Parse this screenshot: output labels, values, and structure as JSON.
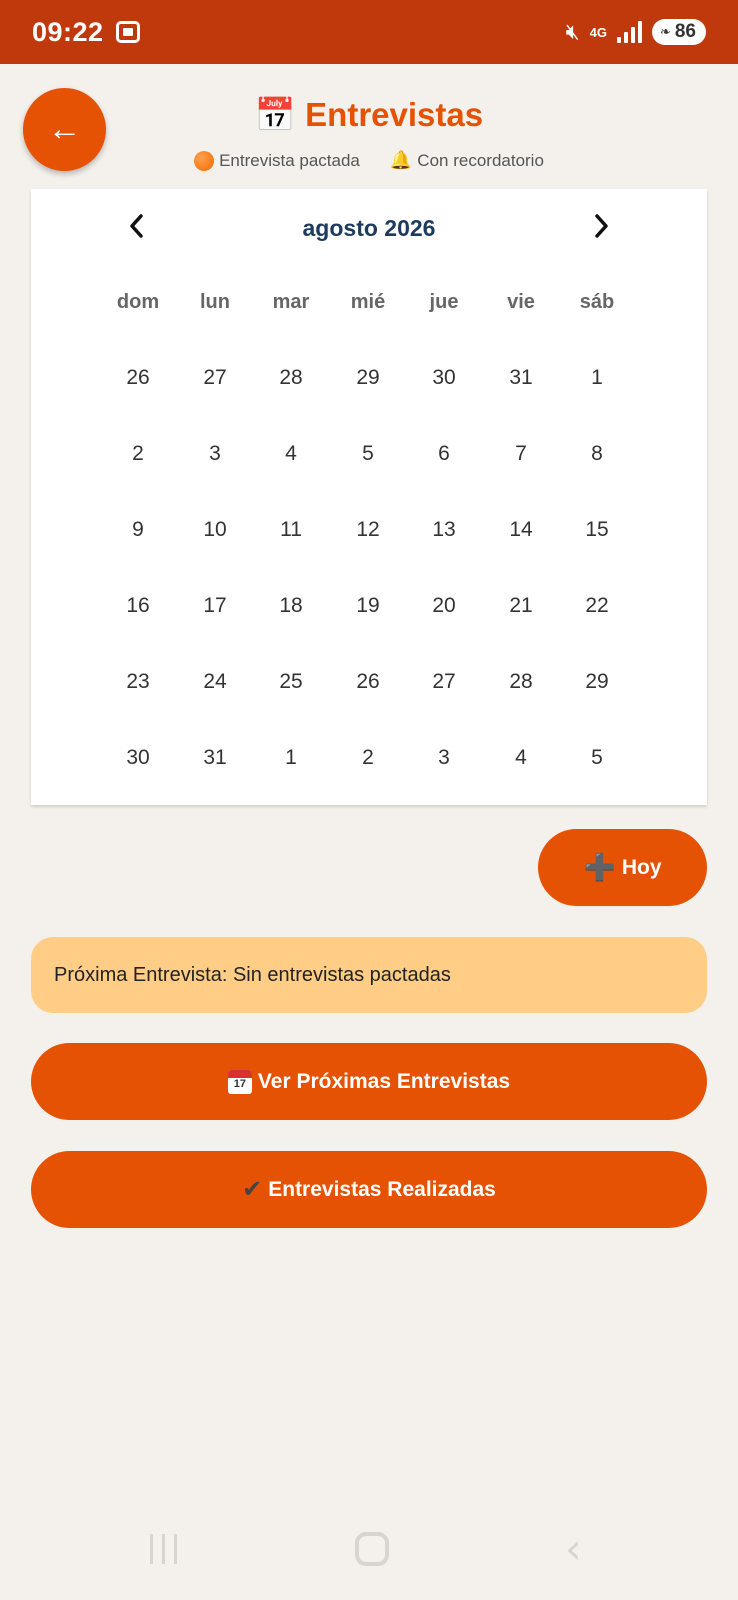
{
  "status_bar": {
    "time": "09:22",
    "network": "4G",
    "battery": "86"
  },
  "header": {
    "back_symbol": "←",
    "title_emoji": "📅",
    "title": "Entrevistas",
    "legend": [
      {
        "icon": "orange-dot",
        "label": "Entrevista pactada"
      },
      {
        "icon": "bell",
        "label": "Con recordatorio"
      }
    ]
  },
  "calendar": {
    "month_title": "agosto 2026",
    "prev_symbol": "‹",
    "next_symbol": "›",
    "weekdays": [
      "dom",
      "lun",
      "mar",
      "mié",
      "jue",
      "vie",
      "sáb"
    ],
    "weeks": [
      [
        "26",
        "27",
        "28",
        "29",
        "30",
        "31",
        "1"
      ],
      [
        "2",
        "3",
        "4",
        "5",
        "6",
        "7",
        "8"
      ],
      [
        "9",
        "10",
        "11",
        "12",
        "13",
        "14",
        "15"
      ],
      [
        "16",
        "17",
        "18",
        "19",
        "20",
        "21",
        "22"
      ],
      [
        "23",
        "24",
        "25",
        "26",
        "27",
        "28",
        "29"
      ],
      [
        "30",
        "31",
        "1",
        "2",
        "3",
        "4",
        "5"
      ]
    ]
  },
  "today_button": {
    "icon": "➕",
    "label": "Hoy"
  },
  "next_interview": "Próxima Entrevista: Sin entrevistas pactadas",
  "buttons": {
    "upcoming": "Ver Próximas Entrevistas",
    "done_icon": "✔",
    "done": "Entrevistas Realizadas"
  },
  "colors": {
    "status_bar": "#c0390d",
    "primary": "#e55204",
    "card": "#ffcd85",
    "month_title": "#1c3b5e",
    "background": "#f4f1ec"
  }
}
